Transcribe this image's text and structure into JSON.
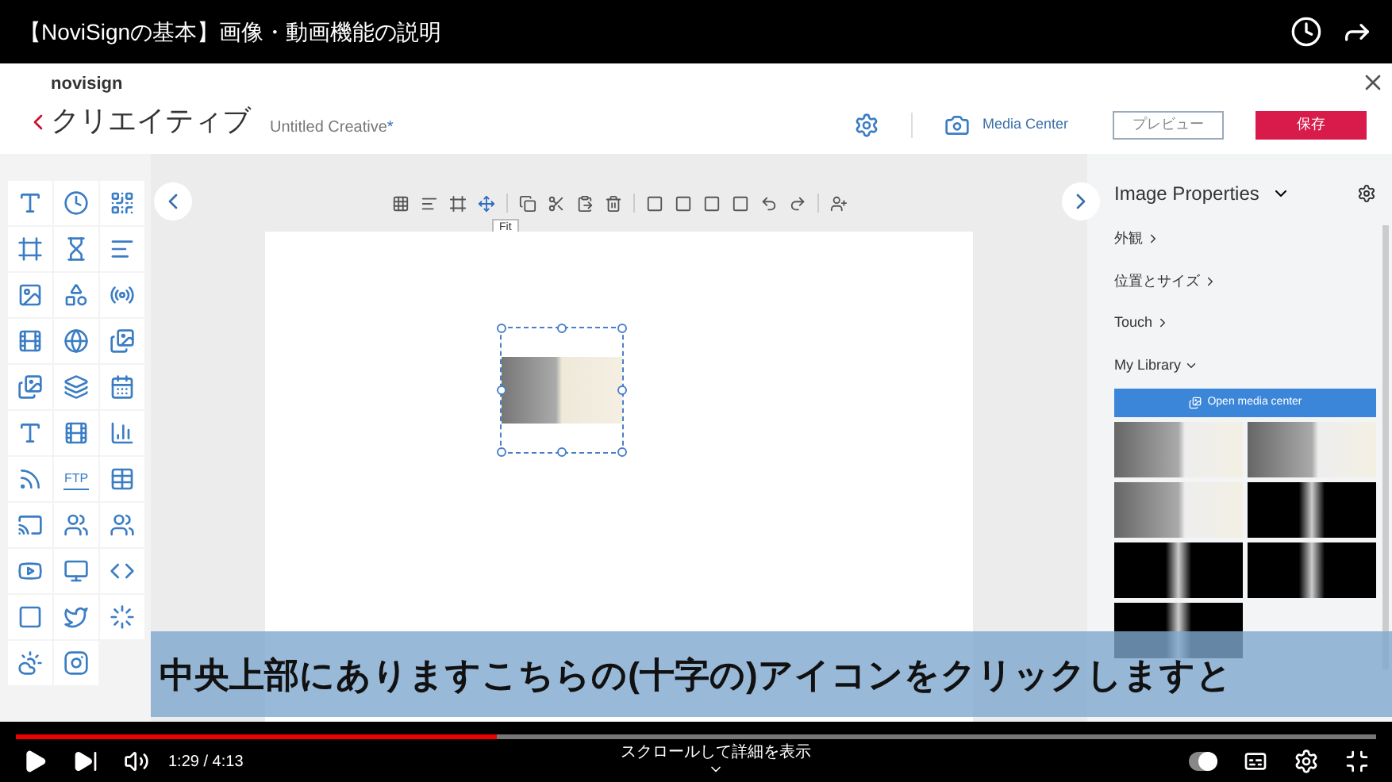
{
  "video_title": "【NoviSignの基本】画像・動画機能の説明",
  "header": {
    "logo_text": "novisign",
    "section": "クリエイティブ",
    "creative_name": "Untitled Creative",
    "modified_mark": "*",
    "media_center": "Media Center",
    "preview": "プレビュー",
    "save": "保存"
  },
  "palette": {
    "ftp_label": "FTP"
  },
  "toolbar": {
    "tooltip": "Fit"
  },
  "properties": {
    "title": "Image Properties",
    "sections": [
      {
        "label": "外観",
        "expanded": false
      },
      {
        "label": "位置とサイズ",
        "expanded": false
      },
      {
        "label": "Touch",
        "expanded": false
      },
      {
        "label": "My Library",
        "expanded": true
      }
    ],
    "open_button": "Open media center",
    "thumbnails": [
      {
        "kind": "light"
      },
      {
        "kind": "light"
      },
      {
        "kind": "light"
      },
      {
        "kind": "dark"
      },
      {
        "kind": "dark"
      },
      {
        "kind": "dark"
      },
      {
        "kind": "dark"
      }
    ]
  },
  "subtitle": "中央上部にありますこちらの(十字の)アイコンをクリックしますと",
  "player": {
    "autoplay_on": true,
    "level": 0.353,
    "time": "1:29 / 4:13",
    "hint": "スクロールして詳細を表示"
  }
}
